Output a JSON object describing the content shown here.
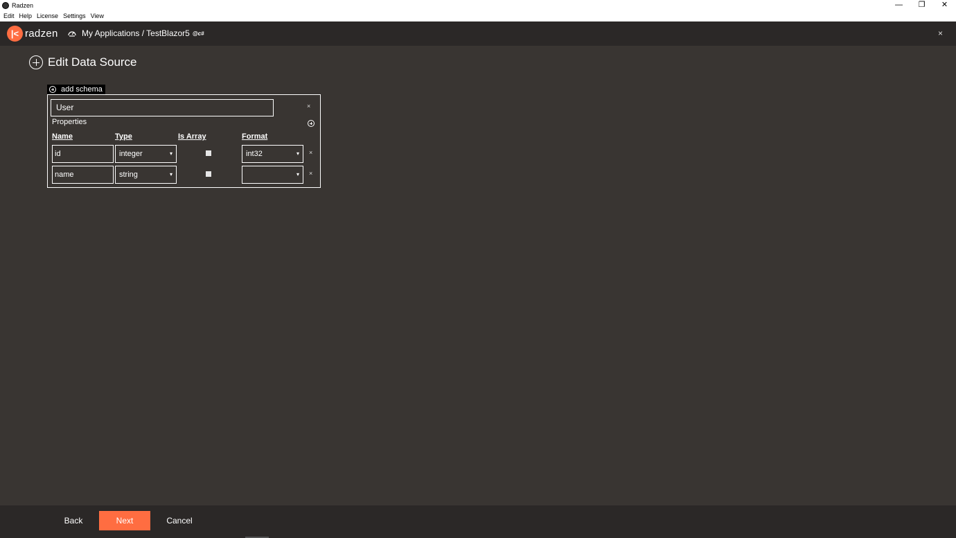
{
  "window": {
    "title": "Radzen",
    "minimize": "—",
    "restore": "❐",
    "close": "✕"
  },
  "menu": [
    "Edit",
    "Help",
    "License",
    "Settings",
    "View"
  ],
  "header": {
    "logo_text": "radzen",
    "breadcrumb": "My Applications / TestBlazor5",
    "badge": "@c#",
    "close": "×"
  },
  "page": {
    "title": "Edit Data Source"
  },
  "schema": {
    "add_label": "add schema",
    "name": "User",
    "remove": "×",
    "properties_label": "Properties",
    "columns": {
      "name": "Name",
      "type": "Type",
      "is_array": "Is Array",
      "format": "Format"
    },
    "rows": [
      {
        "name": "id",
        "type": "integer",
        "is_array": false,
        "format": "int32",
        "remove": "×"
      },
      {
        "name": "name",
        "type": "string",
        "is_array": false,
        "format": "",
        "remove": "×"
      }
    ],
    "caret": "▾"
  },
  "footer": {
    "back": "Back",
    "next": "Next",
    "cancel": "Cancel"
  },
  "colors": {
    "accent": "#ff6d41",
    "background": "#393532",
    "header_bg": "#2b2827"
  }
}
